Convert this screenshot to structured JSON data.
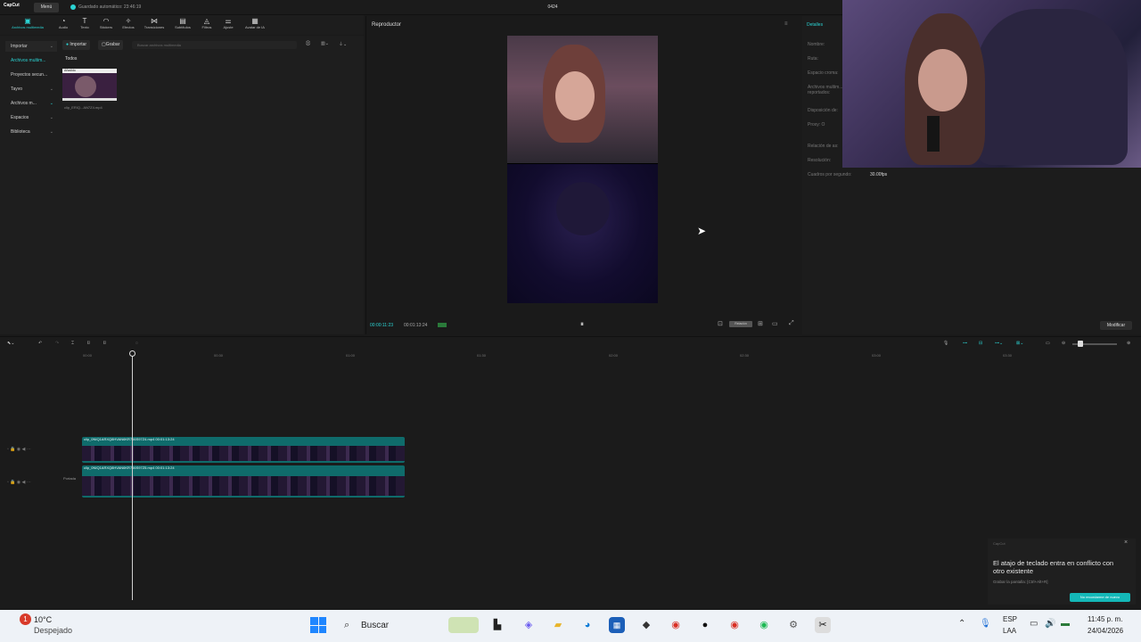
{
  "titlebar": {
    "logo": "CapCut",
    "menu": "Menú",
    "autosave": "Guardado automático: 23:46:19",
    "project_title": "0424"
  },
  "toolbar": {
    "items": [
      {
        "label": "Archivos multimedia",
        "icon": "media-icon"
      },
      {
        "label": "Audio",
        "icon": "audio-icon"
      },
      {
        "label": "Texto",
        "icon": "text-icon"
      },
      {
        "label": "Stickers",
        "icon": "stickers-icon"
      },
      {
        "label": "Efectos",
        "icon": "effects-icon"
      },
      {
        "label": "Transiciones",
        "icon": "transitions-icon"
      },
      {
        "label": "Subtítulos",
        "icon": "subtitles-icon"
      },
      {
        "label": "Filtros",
        "icon": "filters-icon"
      },
      {
        "label": "Ajuste",
        "icon": "adjust-icon"
      },
      {
        "label": "Avatar de IA",
        "icon": "avatar-icon"
      }
    ]
  },
  "media": {
    "sidebar": [
      {
        "label": "Importar"
      },
      {
        "label": "Archivos multim..."
      },
      {
        "label": "Proyectos secun..."
      },
      {
        "label": "Tayvo"
      },
      {
        "label": "Archivos m..."
      },
      {
        "label": "Espacios"
      },
      {
        "label": "Biblioteca"
      }
    ],
    "import_btn": "Importar",
    "record_btn": "Grabar",
    "search_placeholder": "Buscar archivos multimedia",
    "filter_all": "Todos",
    "thumb_badge": "Añadido",
    "file_name": "clip_ERIQ...AN7Z4.mp4"
  },
  "player": {
    "title": "Reproductor",
    "current_time": "00:00:11:23",
    "total_time": "00:01:13:24",
    "ratio_label": "Relación"
  },
  "details": {
    "title": "Detalles",
    "rows": [
      {
        "label": "Nombre:"
      },
      {
        "label": "Ruta:"
      },
      {
        "label": "Espacio croma:"
      },
      {
        "label": "Archivos multim... reportados:"
      },
      {
        "label": "Disposición de:"
      },
      {
        "label": "Proxy: O"
      },
      {
        "label": "Relación de as:"
      },
      {
        "label": "Resolución:"
      },
      {
        "label": "Cuadros por segundo:",
        "value": "30.00fps"
      }
    ],
    "modify_btn": "Modificar"
  },
  "timeline": {
    "ruler": [
      "00:00",
      "00:30",
      "01:00",
      "01:30",
      "02:00",
      "02:30",
      "03:00",
      "03:30"
    ],
    "clips": [
      {
        "label": "clip_0NIQ1ARXQ8HVAN6KR766S97Z4.mp4   00:01:13:24"
      },
      {
        "label": "clip_0NIQ1ARXQ8HVAN6KR766S97Z5.mp4   00:01:13:24"
      }
    ],
    "cover_label": "Portada"
  },
  "toast": {
    "app": "CapCut",
    "message": "El atajo de teclado entra en conflicto con otro existente",
    "sub": "Grabar la pantalla: [Ctrl+Alt+R]",
    "button": "No recordarme de nuevo"
  },
  "taskbar": {
    "weather_temp": "10°C",
    "weather_desc": "Despejado",
    "search": "Buscar",
    "lang": "ESP",
    "lang2": "LAA",
    "time": "11:45 p. m.",
    "date": "24/04/2026",
    "badge": "1"
  }
}
